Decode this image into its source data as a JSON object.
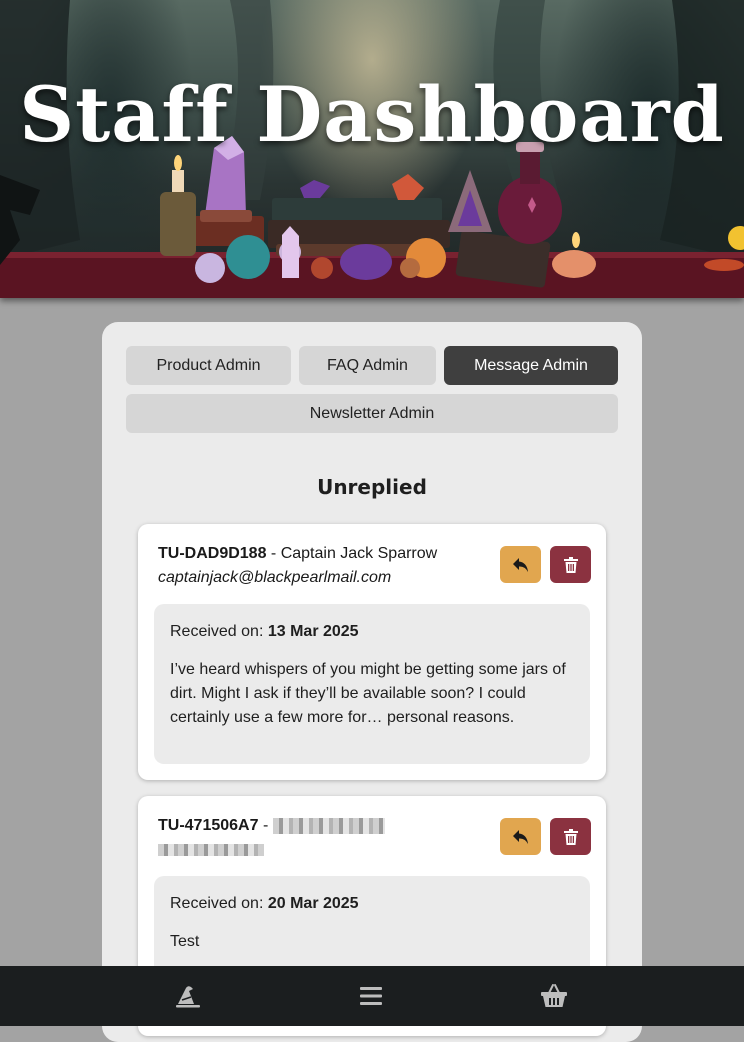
{
  "header": {
    "title": "Staff Dashboard"
  },
  "tabs": [
    {
      "label": "Product Admin",
      "active": false
    },
    {
      "label": "FAQ Admin",
      "active": false
    },
    {
      "label": "Message Admin",
      "active": true
    },
    {
      "label": "Newsletter Admin",
      "active": false
    }
  ],
  "section": {
    "heading": "Unreplied"
  },
  "messages": [
    {
      "id": "TU-DAD9D188",
      "separator": " - ",
      "name": "Captain Jack Sparrow",
      "email": "captainjack@blackpearlmail.com",
      "received_label": "Received on: ",
      "received_date": "13 Mar 2025",
      "text": "I’ve heard whispers of you might be getting some jars of dirt. Might I ask if they’ll be available soon? I could certainly use a few more for… personal reasons."
    },
    {
      "id": "TU-471506A7",
      "separator": " - ",
      "name_redacted": true,
      "email_redacted": true,
      "received_label": "Received on: ",
      "received_date": "20 Mar 2025",
      "text": "Test"
    }
  ],
  "actions": {
    "reply_icon": "reply-icon",
    "delete_icon": "trash-icon"
  },
  "bottom_nav": [
    {
      "icon": "wizard-hat-icon"
    },
    {
      "icon": "menu-icon"
    },
    {
      "icon": "basket-icon"
    }
  ],
  "colors": {
    "page_bg": "#a3a3a3",
    "panel_bg": "#ebebeb",
    "active_tab": "#3f3f3f",
    "reply": "#e1a64f",
    "delete": "#8b3240",
    "bottom_bar": "#1b1e1f"
  }
}
